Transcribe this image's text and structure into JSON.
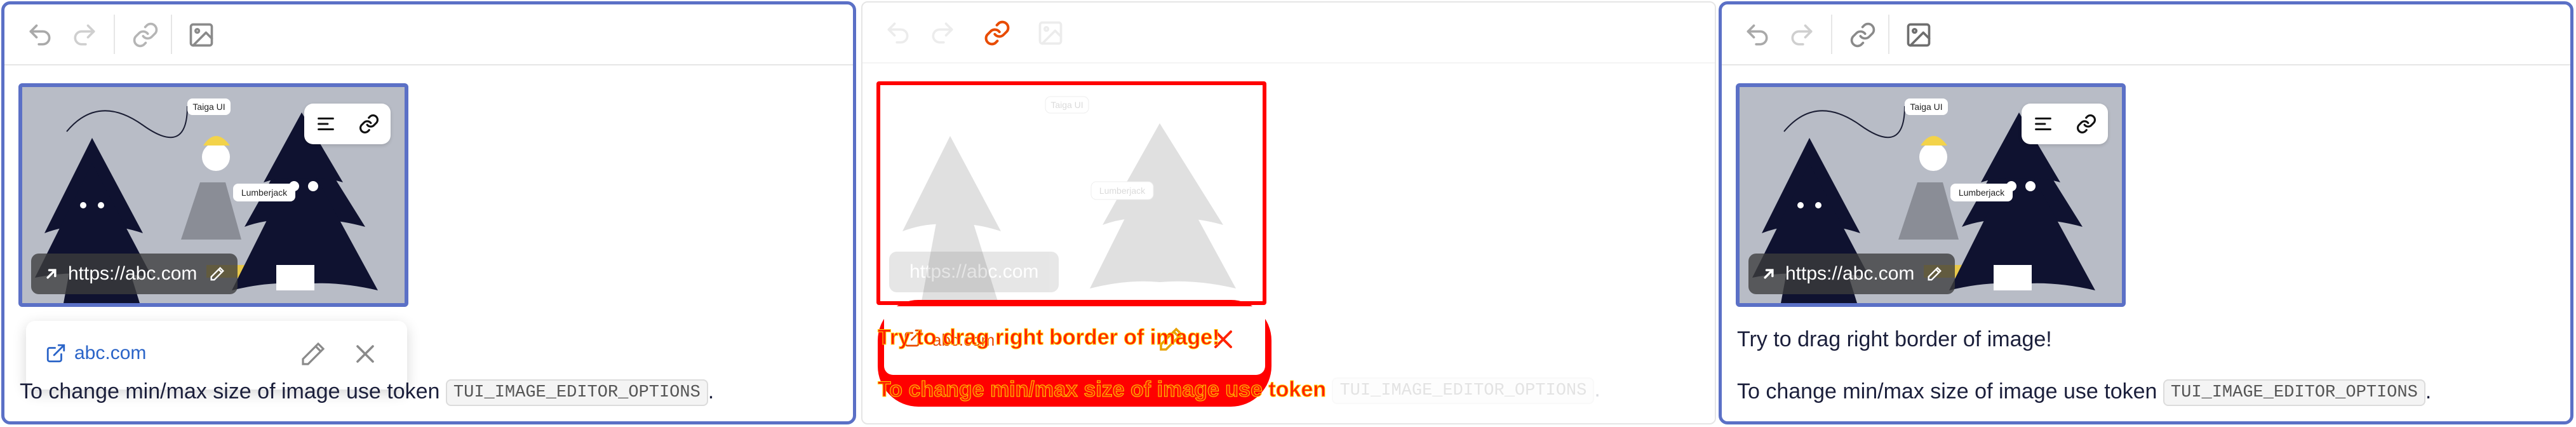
{
  "colors": {
    "accent": "#5b70c6",
    "link": "#2a64c8",
    "highlight": "#ff0000",
    "active_icon": "#e84b00"
  },
  "toolbar": {
    "undo_icon": "undo-icon",
    "redo_icon": "redo-icon",
    "link_icon": "link-icon",
    "image_icon": "image-icon"
  },
  "image": {
    "labels": {
      "taiga": "Taiga UI",
      "lumberjack": "Lumberjack"
    },
    "link_url": "https://abc.com",
    "tools": [
      "align-icon",
      "link-icon"
    ]
  },
  "link_card": {
    "label": "abc.com"
  },
  "content": {
    "drag_hint": "Try to drag right border of image!",
    "minmax_text": "To change min/max size of image use token",
    "token": "TUI_IMAGE_EDITOR_OPTIONS",
    "period": "."
  }
}
